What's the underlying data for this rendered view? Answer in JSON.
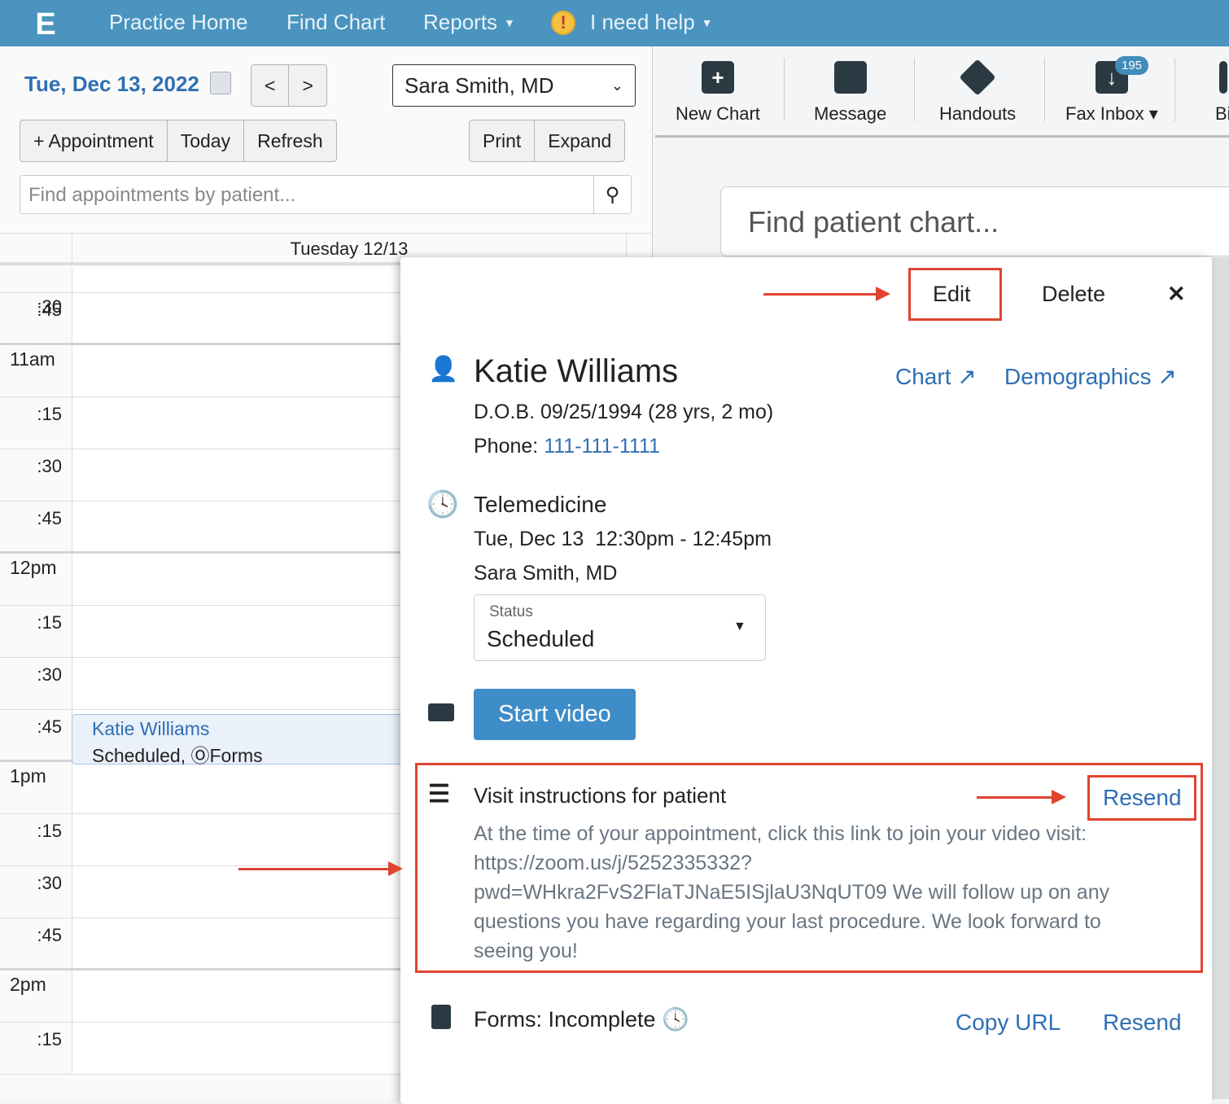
{
  "nav": {
    "items": [
      "Practice Home",
      "Find Chart",
      "Reports",
      "I need help"
    ]
  },
  "left": {
    "date": "Tue, Dec 13, 2022",
    "prev": "<",
    "next": ">",
    "provider": "Sara Smith, MD",
    "buttons": [
      "+ Appointment",
      "Today",
      "Refresh"
    ],
    "buttons2": [
      "Print",
      "Expand"
    ],
    "search_placeholder": "Find appointments by patient...",
    "day_header": "Tuesday 12/13"
  },
  "slots": [
    ":30",
    ":45",
    "11am",
    ":15",
    ":30",
    ":45",
    "12pm",
    ":15",
    ":30",
    ":45",
    "1pm",
    ":15",
    ":30",
    ":45",
    "2pm",
    ":15"
  ],
  "appointment": {
    "name": "Katie Williams",
    "status": "Scheduled, ⓄForms"
  },
  "toolbar": {
    "items": [
      "New Chart",
      "Message",
      "Handouts",
      "Fax Inbox ▾",
      "Bi"
    ],
    "fax_badge": "195"
  },
  "find_chart_placeholder": "Find patient chart...",
  "popup": {
    "edit": "Edit",
    "delete": "Delete",
    "close": "✕",
    "patient_name": "Katie Williams",
    "chart_link": "Chart ↗",
    "demographics_link": "Demographics ↗",
    "dob": "D.O.B. 09/25/1994 (28 yrs, 2 mo)",
    "phone_label": "Phone: ",
    "phone": "111-111-1111",
    "visit_type": "Telemedicine",
    "visit_time": "Tue, Dec 13  12:30pm - 12:45pm",
    "visit_provider": "Sara Smith, MD",
    "status_label": "Status",
    "status_value": "Scheduled",
    "start_video": "Start video",
    "instructions_title": "Visit instructions for patient",
    "instructions_resend": "Resend",
    "instructions_text": "At the time of your appointment, click this link to join your video visit: https://zoom.us/j/5252335332?pwd=WHkra2FvS2FlaTJNaE5ISjlaU3NqUT09 We will follow up on any questions you have regarding your last procedure. We look forward to seeing you!",
    "forms_label": "Forms: Incomplete",
    "copy_url": "Copy URL",
    "forms_resend": "Resend"
  }
}
